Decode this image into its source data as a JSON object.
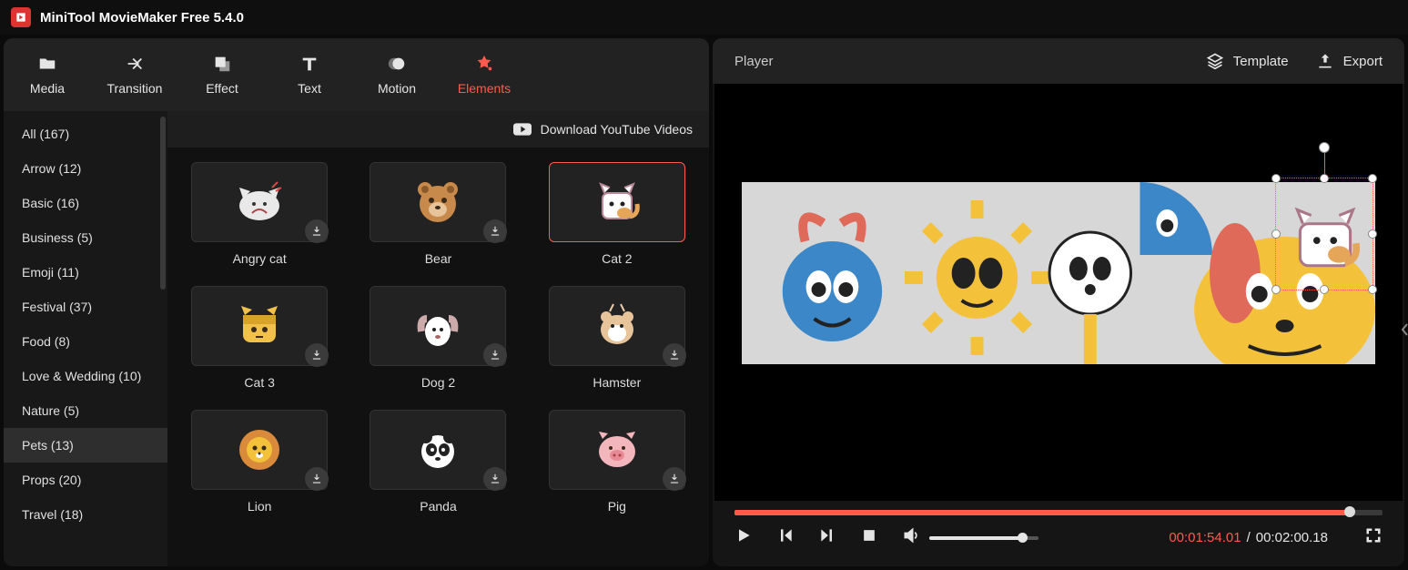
{
  "app": {
    "title": "MiniTool MovieMaker Free 5.4.0"
  },
  "toolbar": [
    {
      "id": "media",
      "label": "Media"
    },
    {
      "id": "transition",
      "label": "Transition"
    },
    {
      "id": "effect",
      "label": "Effect"
    },
    {
      "id": "text",
      "label": "Text"
    },
    {
      "id": "motion",
      "label": "Motion"
    },
    {
      "id": "elements",
      "label": "Elements",
      "active": true
    }
  ],
  "sidebar": {
    "items": [
      {
        "label": "All (167)"
      },
      {
        "label": "Arrow (12)"
      },
      {
        "label": "Basic (16)"
      },
      {
        "label": "Business (5)"
      },
      {
        "label": "Emoji (11)"
      },
      {
        "label": "Festival (37)"
      },
      {
        "label": "Food (8)"
      },
      {
        "label": "Love & Wedding (10)"
      },
      {
        "label": "Nature (5)"
      },
      {
        "label": "Pets (13)",
        "selected": true
      },
      {
        "label": "Props (20)"
      },
      {
        "label": "Travel (18)"
      }
    ]
  },
  "gallery": {
    "top_link": "Download YouTube Videos",
    "items": [
      {
        "label": "Angry cat",
        "icon": "angry-cat",
        "download": true
      },
      {
        "label": "Bear",
        "icon": "bear",
        "download": true
      },
      {
        "label": "Cat 2",
        "icon": "cat2",
        "selected": true
      },
      {
        "label": "Cat 3",
        "icon": "cat3",
        "download": true
      },
      {
        "label": "Dog 2",
        "icon": "dog2",
        "download": true
      },
      {
        "label": "Hamster",
        "icon": "hamster",
        "download": true
      },
      {
        "label": "Lion",
        "icon": "lion",
        "download": true
      },
      {
        "label": "Panda",
        "icon": "panda",
        "download": true
      },
      {
        "label": "Pig",
        "icon": "pig",
        "download": true
      }
    ]
  },
  "player": {
    "title": "Player",
    "template_label": "Template",
    "export_label": "Export",
    "time_current": "00:01:54.01",
    "time_total": "00:02:00.18",
    "time_sep": " / ",
    "progress_pct": 95,
    "volume_pct": 85
  }
}
